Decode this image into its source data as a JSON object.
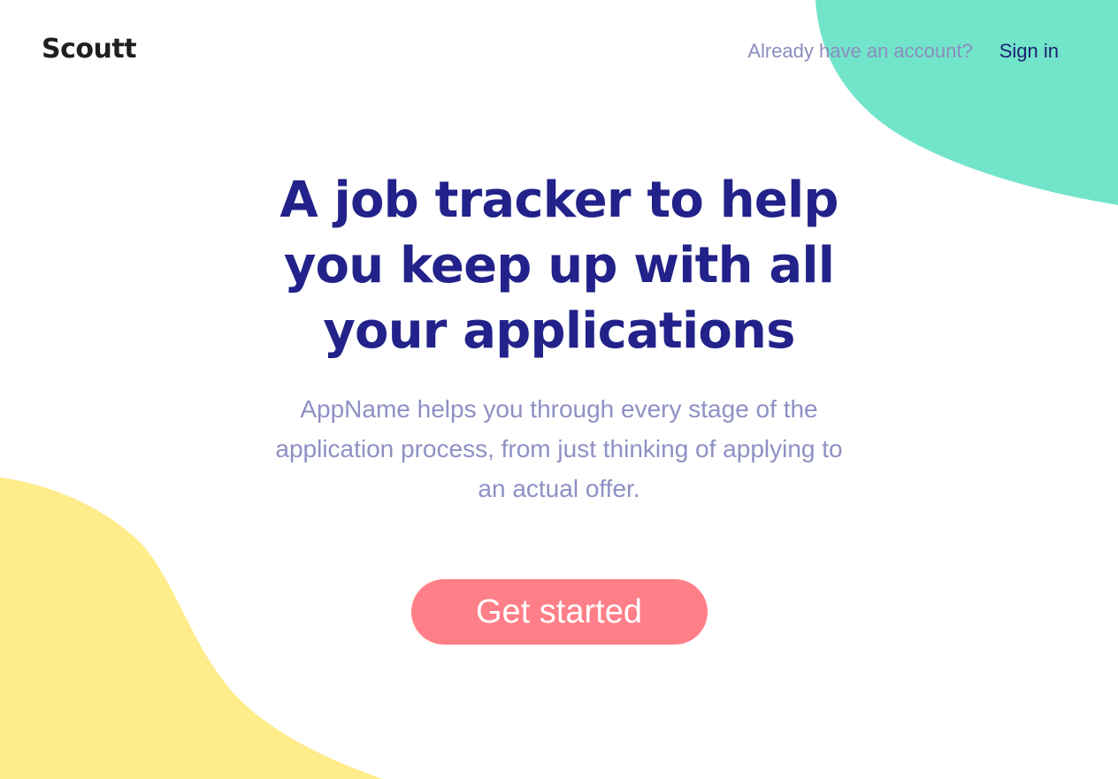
{
  "brand": {
    "name": "Scoutt"
  },
  "nav": {
    "prompt": "Already have an account?",
    "signin_label": "Sign in"
  },
  "hero": {
    "headline": "A job tracker to help you keep up with all your applications",
    "subtext": "AppName helps you through every stage of the application process, from just thinking of applying to an actual offer.",
    "cta_label": "Get started"
  },
  "colors": {
    "background": "#ffffff",
    "headline": "#22228a",
    "subtext": "#8e90c4",
    "link": "#1c2173",
    "cta": "#ff7f88",
    "blob_teal": "#72e4c9",
    "blob_yellow": "#ffec8a"
  }
}
